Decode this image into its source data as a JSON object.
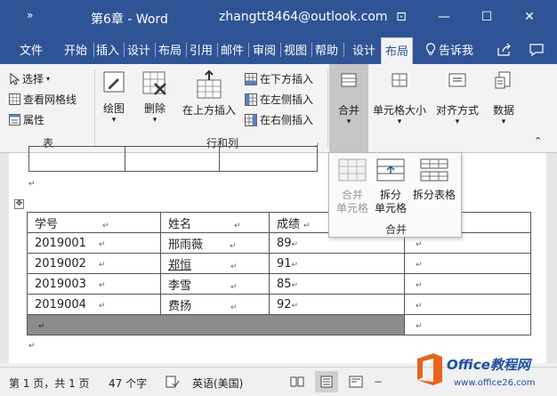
{
  "titlebar": {
    "qat": "»",
    "doc_title": "第6章 - Word",
    "account": "zhangtt8464@outlook.com",
    "buttons": [
      "⊡",
      "—",
      "☐",
      "✕"
    ]
  },
  "tabs": [
    "文件",
    "开始",
    "插入",
    "设计",
    "布局",
    "引用",
    "邮件",
    "审阅",
    "视图",
    "帮助",
    "设计",
    "布局",
    "告诉我"
  ],
  "tab_icons": {
    "tell": "lightbulb-icon",
    "share": "share-icon",
    "comment": "comment-icon"
  },
  "ribbon": {
    "table_group": {
      "select": "选择",
      "gridlines": "查看网格线",
      "properties": "属性",
      "label": "表"
    },
    "draw": "绘图",
    "delete": "删除",
    "insert_above": "在上方插入",
    "insert_below": "在下方插入",
    "insert_left": "在左侧插入",
    "insert_right": "在右侧插入",
    "rows_cols_label": "行和列",
    "merge": "合并",
    "cell_size": "单元格大小",
    "alignment": "对齐方式",
    "data": "数据"
  },
  "merge_popup": {
    "merge_cells_1": "合并",
    "merge_cells_2": "单元格",
    "split_cells_1": "拆分",
    "split_cells_2": "单元格",
    "split_table": "拆分表格",
    "label": "合并"
  },
  "table": {
    "headers": [
      "学号",
      "姓名",
      "成绩"
    ],
    "rows": [
      [
        "2019001",
        "邢雨薇",
        "89"
      ],
      [
        "2019002",
        "郑恒",
        "91"
      ],
      [
        "2019003",
        "李雪",
        "85"
      ],
      [
        "2019004",
        "费扬",
        "92"
      ]
    ],
    "cell_mark": "↵"
  },
  "statusbar": {
    "page": "第 1 页，共 1 页",
    "words": "47 个字",
    "language": "英语(美国)"
  },
  "brand": {
    "text": "Office教程网",
    "url": "www.office26.com"
  }
}
